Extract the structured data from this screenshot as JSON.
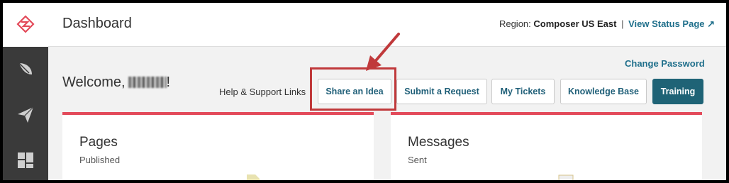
{
  "header": {
    "title": "Dashboard",
    "region_label": "Region:",
    "region_value": "Composer US East",
    "separator": "|",
    "status_link": "View Status Page ↗"
  },
  "welcome": {
    "prefix": "Welcome,",
    "suffix": "!"
  },
  "account": {
    "change_password": "Change Password"
  },
  "support": {
    "label": "Help & Support Links",
    "buttons": [
      "Share an Idea",
      "Submit a Request",
      "My Tickets",
      "Knowledge Base",
      "Training"
    ]
  },
  "cards": [
    {
      "title": "Pages",
      "subtitle": "Published"
    },
    {
      "title": "Messages",
      "subtitle": "Sent"
    }
  ],
  "sidebar": {
    "icons": [
      "composer-logo-icon",
      "feather-icon",
      "paper-plane-icon",
      "dashboard-grid-icon"
    ]
  },
  "colors": {
    "accent_red": "#e34a5a",
    "link_teal": "#1f6f8b",
    "primary_button": "#1f6376",
    "callout_red": "#c0393b",
    "sidebar_dark": "#3a3a3a"
  }
}
